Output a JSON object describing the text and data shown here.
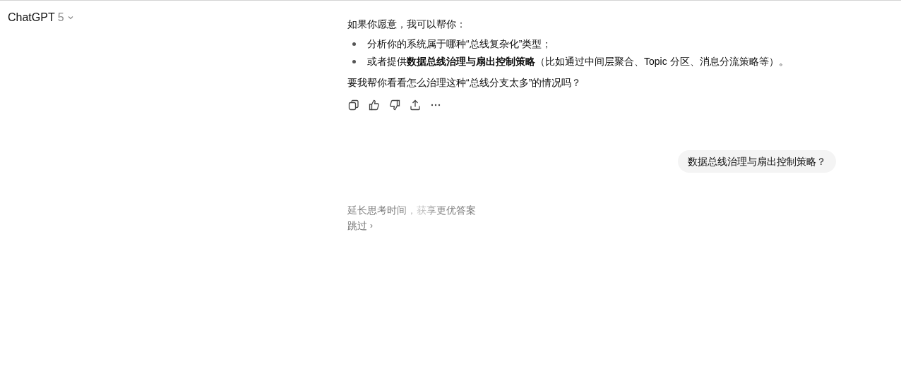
{
  "header": {
    "model": "ChatGPT",
    "version": "5"
  },
  "assistant_message": {
    "intro": "如果你愿意，我可以帮你：",
    "bullets": [
      "分析你的系统属于哪种“总线复杂化”类型；",
      "或者提供**数据总线治理与扇出控制策略**（比如通过中间层聚合、Topic 分区、消息分流策略等）。"
    ],
    "question": "要我帮你看看怎么治理这种“总线分支太多”的情况吗？",
    "actions": [
      {
        "kind": "copy"
      },
      {
        "kind": "like"
      },
      {
        "kind": "dislike"
      },
      {
        "kind": "share"
      },
      {
        "kind": "more"
      }
    ]
  },
  "user_message": "数据总线治理与扇出控制策略？",
  "thinking": {
    "status": "延长思考时间，获享更优答案",
    "skip": "跳过",
    "skip_icon": "›"
  }
}
